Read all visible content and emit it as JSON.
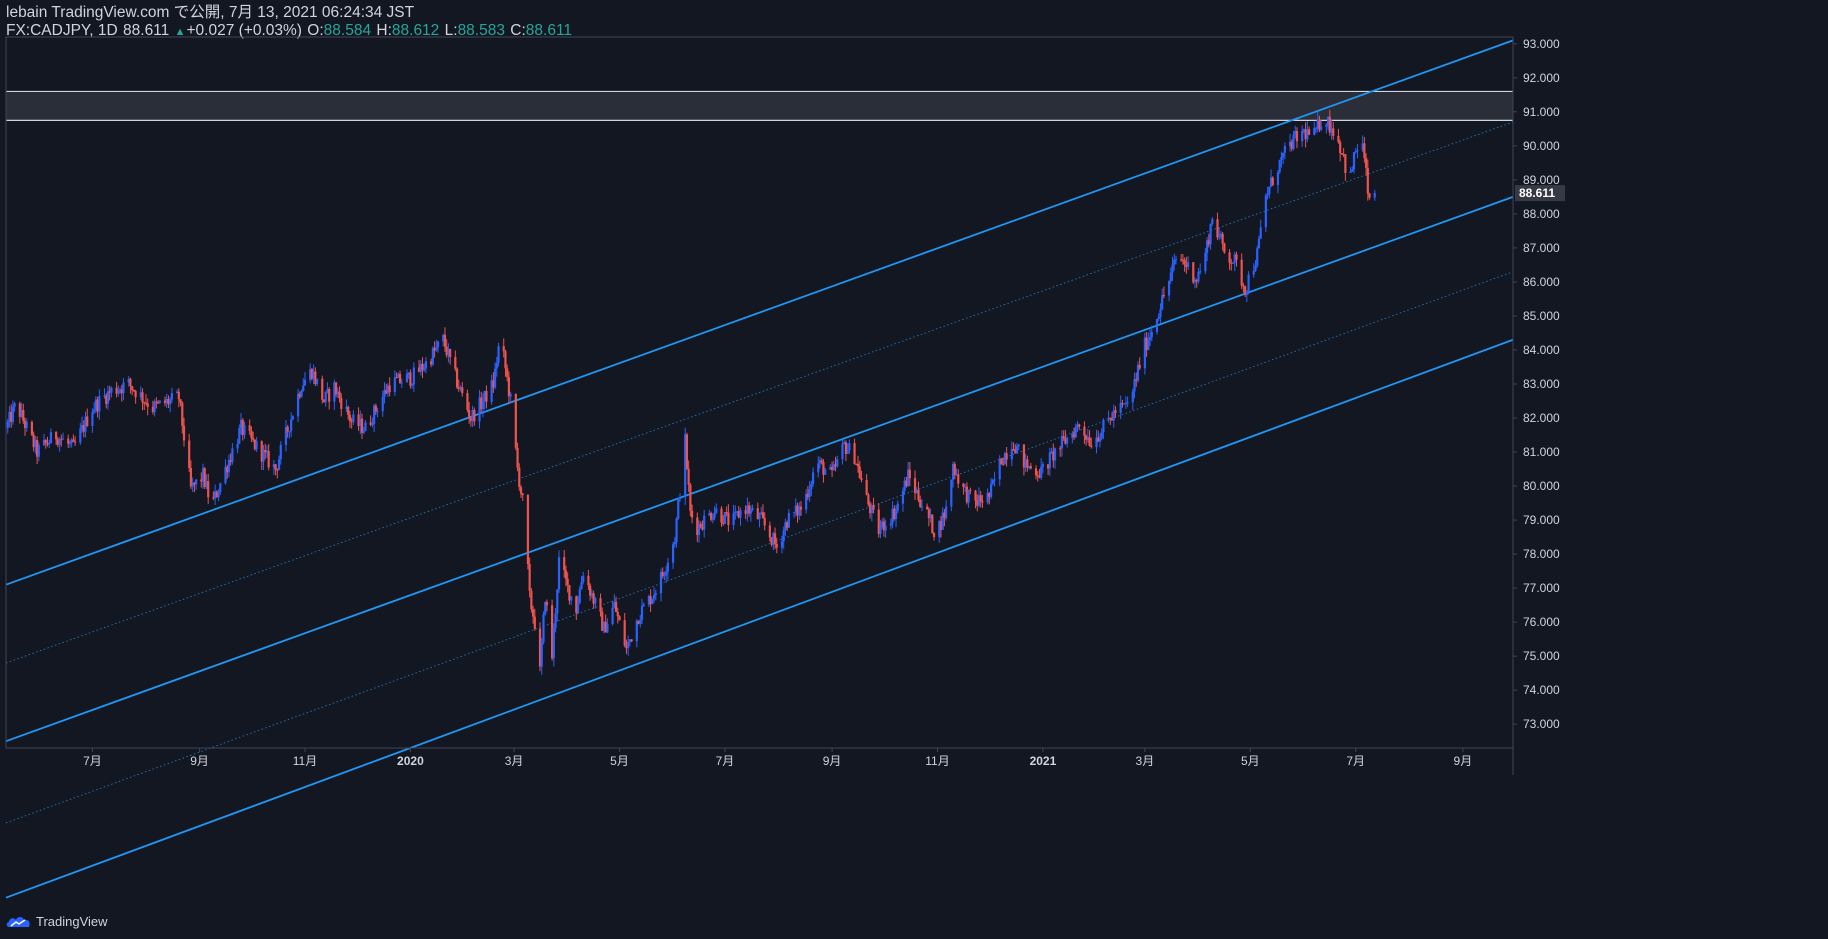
{
  "header": {
    "publish_line": "lebain TradingView.com で公開, 7月 13, 2021 06:24:34 JST",
    "symbol_info": "FX:CADJPY, 1D",
    "last_price": "88.611",
    "change_arrow": "▲",
    "change": "+0.027 (+0.03%)",
    "open_label": "O:",
    "open": "88.584",
    "high_label": "H:",
    "high": "88.612",
    "low_label": "L:",
    "low": "88.583",
    "close_label": "C:",
    "close": "88.611"
  },
  "footer": {
    "brand": "TradingView"
  },
  "colors": {
    "background": "#131722",
    "up_candle": "#2962ff",
    "down_candle": "#ef5350",
    "channel_line": "#2196f3",
    "zone_fill": "#2a2e39",
    "zone_line": "#d1d4dc",
    "axis_text": "#d1d4dc"
  },
  "chart_data": {
    "type": "candlestick",
    "symbol": "CADJPY",
    "timeframe": "1D",
    "ylim": [
      72.3,
      93.2
    ],
    "y_ticks": [
      73.0,
      74.0,
      75.0,
      76.0,
      77.0,
      78.0,
      79.0,
      80.0,
      81.0,
      82.0,
      83.0,
      84.0,
      85.0,
      86.0,
      87.0,
      88.0,
      89.0,
      90.0,
      91.0,
      92.0,
      93.0
    ],
    "y_tick_labels": [
      "73.000",
      "74.000",
      "75.000",
      "76.000",
      "77.000",
      "78.000",
      "79.000",
      "80.000",
      "81.000",
      "82.000",
      "83.000",
      "84.000",
      "85.000",
      "86.000",
      "87.000",
      "88.000",
      "89.000",
      "90.000",
      "91.000",
      "92.000",
      "93.000"
    ],
    "price_label": "88.611",
    "x_range": [
      "2019-05-12",
      "2021-09-30"
    ],
    "x_ticks": [
      {
        "date": "2019-07-01",
        "label": "7月"
      },
      {
        "date": "2019-09-01",
        "label": "9月"
      },
      {
        "date": "2019-11-01",
        "label": "11月"
      },
      {
        "date": "2020-01-01",
        "label": "2020"
      },
      {
        "date": "2020-03-01",
        "label": "3月"
      },
      {
        "date": "2020-05-01",
        "label": "5月"
      },
      {
        "date": "2020-07-01",
        "label": "7月"
      },
      {
        "date": "2020-09-01",
        "label": "9月"
      },
      {
        "date": "2020-11-01",
        "label": "11月"
      },
      {
        "date": "2021-01-01",
        "label": "2021"
      },
      {
        "date": "2021-03-01",
        "label": "3月"
      },
      {
        "date": "2021-05-01",
        "label": "5月"
      },
      {
        "date": "2021-07-01",
        "label": "7月"
      },
      {
        "date": "2021-09-01",
        "label": "9月"
      }
    ],
    "keypoints": [
      [
        "2019-05-12",
        81.7
      ],
      [
        "2019-05-18",
        82.4
      ],
      [
        "2019-05-30",
        81.0
      ],
      [
        "2019-06-10",
        81.5
      ],
      [
        "2019-06-20",
        81.1
      ],
      [
        "2019-07-01",
        82.3
      ],
      [
        "2019-07-12",
        82.8
      ],
      [
        "2019-07-22",
        83.0
      ],
      [
        "2019-08-05",
        82.3
      ],
      [
        "2019-08-20",
        82.6
      ],
      [
        "2019-08-27",
        79.9
      ],
      [
        "2019-09-03",
        80.3
      ],
      [
        "2019-09-08",
        79.4
      ],
      [
        "2019-09-16",
        80.5
      ],
      [
        "2019-09-25",
        81.7
      ],
      [
        "2019-10-03",
        81.2
      ],
      [
        "2019-10-15",
        80.5
      ],
      [
        "2019-10-30",
        83.0
      ],
      [
        "2019-11-05",
        83.4
      ],
      [
        "2019-11-12",
        82.5
      ],
      [
        "2019-11-18",
        82.9
      ],
      [
        "2019-11-28",
        81.9
      ],
      [
        "2019-12-06",
        81.7
      ],
      [
        "2019-12-20",
        83.0
      ],
      [
        "2020-01-02",
        83.2
      ],
      [
        "2020-01-10",
        83.6
      ],
      [
        "2020-01-20",
        84.3
      ],
      [
        "2020-01-27",
        83.2
      ],
      [
        "2020-02-05",
        82.0
      ],
      [
        "2020-02-12",
        82.5
      ],
      [
        "2020-02-18",
        83.0
      ],
      [
        "2020-02-22",
        84.4
      ],
      [
        "2020-02-28",
        82.5
      ],
      [
        "2020-03-03",
        80.5
      ],
      [
        "2020-03-07",
        79.2
      ],
      [
        "2020-03-10",
        76.7
      ],
      [
        "2020-03-13",
        76.0
      ],
      [
        "2020-03-16",
        74.5
      ],
      [
        "2020-03-19",
        76.8
      ],
      [
        "2020-03-23",
        75.0
      ],
      [
        "2020-03-27",
        77.8
      ],
      [
        "2020-04-01",
        77.0
      ],
      [
        "2020-04-06",
        76.4
      ],
      [
        "2020-04-10",
        77.5
      ],
      [
        "2020-04-15",
        76.8
      ],
      [
        "2020-04-22",
        75.8
      ],
      [
        "2020-04-28",
        76.5
      ],
      [
        "2020-05-05",
        75.2
      ],
      [
        "2020-05-12",
        76.2
      ],
      [
        "2020-05-20",
        76.8
      ],
      [
        "2020-05-26",
        77.4
      ],
      [
        "2020-06-02",
        78.5
      ],
      [
        "2020-06-08",
        81.3
      ],
      [
        "2020-06-11",
        79.2
      ],
      [
        "2020-06-15",
        78.8
      ],
      [
        "2020-06-25",
        79.3
      ],
      [
        "2020-07-05",
        78.9
      ],
      [
        "2020-07-12",
        79.4
      ],
      [
        "2020-07-22",
        79.0
      ],
      [
        "2020-07-31",
        78.2
      ],
      [
        "2020-08-06",
        79.0
      ],
      [
        "2020-08-15",
        79.4
      ],
      [
        "2020-08-23",
        80.7
      ],
      [
        "2020-09-01",
        80.3
      ],
      [
        "2020-09-08",
        81.2
      ],
      [
        "2020-09-14",
        80.9
      ],
      [
        "2020-09-21",
        79.6
      ],
      [
        "2020-09-28",
        78.7
      ],
      [
        "2020-10-08",
        79.3
      ],
      [
        "2020-10-15",
        80.3
      ],
      [
        "2020-10-22",
        79.6
      ],
      [
        "2020-10-31",
        78.6
      ],
      [
        "2020-11-06",
        79.3
      ],
      [
        "2020-11-10",
        80.6
      ],
      [
        "2020-11-16",
        79.9
      ],
      [
        "2020-11-22",
        79.5
      ],
      [
        "2020-12-01",
        79.7
      ],
      [
        "2020-12-08",
        80.8
      ],
      [
        "2020-12-15",
        81.3
      ],
      [
        "2020-12-22",
        80.6
      ],
      [
        "2020-12-31",
        80.4
      ],
      [
        "2021-01-08",
        81.0
      ],
      [
        "2021-01-15",
        81.4
      ],
      [
        "2021-01-22",
        81.8
      ],
      [
        "2021-01-29",
        81.3
      ],
      [
        "2021-02-05",
        81.7
      ],
      [
        "2021-02-12",
        82.2
      ],
      [
        "2021-02-20",
        82.4
      ],
      [
        "2021-02-28",
        84.0
      ],
      [
        "2021-03-05",
        84.6
      ],
      [
        "2021-03-12",
        85.6
      ],
      [
        "2021-03-20",
        86.8
      ],
      [
        "2021-03-25",
        86.5
      ],
      [
        "2021-03-31",
        86.1
      ],
      [
        "2021-04-05",
        86.8
      ],
      [
        "2021-04-09",
        87.9
      ],
      [
        "2021-04-16",
        86.9
      ],
      [
        "2021-04-22",
        86.6
      ],
      [
        "2021-04-28",
        85.8
      ],
      [
        "2021-05-05",
        86.8
      ],
      [
        "2021-05-10",
        88.5
      ],
      [
        "2021-05-17",
        89.4
      ],
      [
        "2021-05-25",
        90.1
      ],
      [
        "2021-06-01",
        90.4
      ],
      [
        "2021-06-07",
        90.3
      ],
      [
        "2021-06-12",
        90.9
      ],
      [
        "2021-06-19",
        90.4
      ],
      [
        "2021-06-24",
        89.7
      ],
      [
        "2021-06-27",
        88.8
      ],
      [
        "2021-07-01",
        89.9
      ],
      [
        "2021-07-05",
        90.0
      ],
      [
        "2021-07-08",
        88.7
      ],
      [
        "2021-07-10",
        87.8
      ],
      [
        "2021-07-12",
        88.611
      ]
    ],
    "channel": {
      "lines": [
        {
          "x1": "2019-05-12",
          "y1": 77.1,
          "x2": "2021-09-30",
          "y2": 93.1,
          "style": "solid"
        },
        {
          "x1": "2019-05-12",
          "y1": 74.8,
          "x2": "2021-09-30",
          "y2": 90.7,
          "style": "dotted"
        },
        {
          "x1": "2019-05-12",
          "y1": 72.5,
          "x2": "2021-09-30",
          "y2": 88.5,
          "style": "solid"
        },
        {
          "x1": "2019-05-12",
          "y1": 70.1,
          "x2": "2021-09-30",
          "y2": 86.3,
          "style": "dotted"
        },
        {
          "x1": "2019-05-12",
          "y1": 67.9,
          "x2": "2021-09-30",
          "y2": 84.3,
          "style": "solid"
        }
      ]
    },
    "resistance_zone": {
      "low": 90.75,
      "high": 91.6
    }
  }
}
